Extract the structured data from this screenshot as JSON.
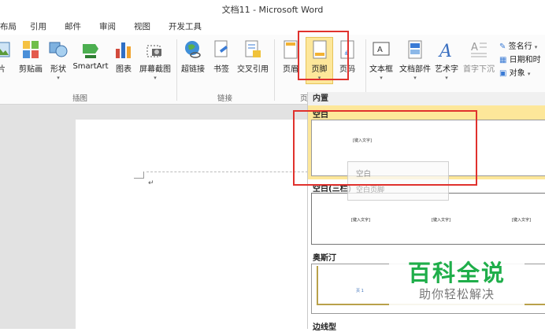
{
  "window": {
    "title": "文档11 - Microsoft Word"
  },
  "tabs": [
    "布局",
    "引用",
    "邮件",
    "审阅",
    "视图",
    "开发工具"
  ],
  "ribbon": {
    "buttons": [
      "片",
      "剪贴画",
      "形状",
      "SmartArt",
      "图表",
      "屏幕截图",
      "超链接",
      "书签",
      "交叉引用",
      "页眉",
      "页脚",
      "页码",
      "文本框",
      "文档部件",
      "艺术字",
      "首字下沉"
    ],
    "small_buttons": [
      "签名行",
      "日期和时",
      "对象"
    ],
    "groups": [
      "插图",
      "链接",
      "页"
    ]
  },
  "gallery": {
    "section_builtin": "内置",
    "items": [
      {
        "label": "空白",
        "placeholder": "[键入文字]"
      },
      {
        "label": "空白(三栏)",
        "placeholders": [
          "[键入文字]",
          "[键入文字]",
          "[键入文字]"
        ]
      },
      {
        "label": "奥斯汀",
        "placeholder": "页 1"
      },
      {
        "label": "边线型"
      }
    ],
    "tooltip": {
      "title": "空白",
      "desc": "空白页脚"
    }
  },
  "document": {
    "paragraph_mark": "↵"
  },
  "watermark": {
    "title": "百科全说",
    "subtitle": "助你轻松解决"
  },
  "colors": {
    "highlight": "#fde79a",
    "annotation_red": "#e0312d",
    "watermark_green": "#1fae4a"
  }
}
